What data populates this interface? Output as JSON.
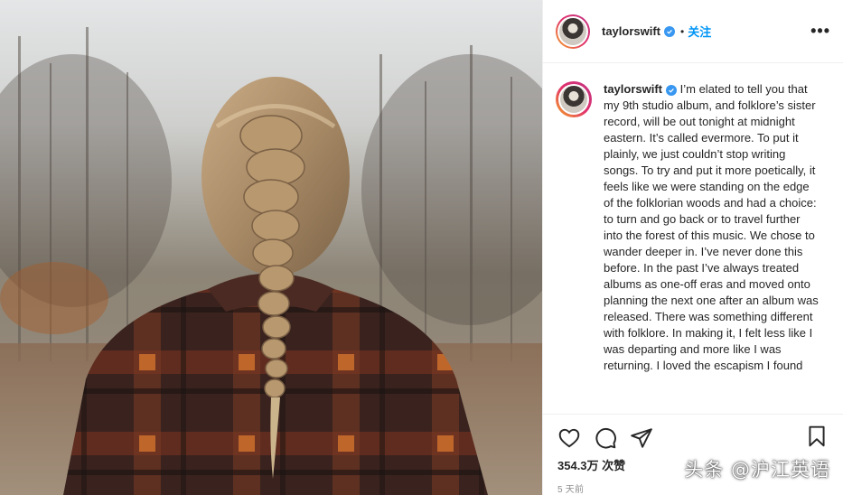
{
  "header": {
    "username": "taylorswift",
    "separator": "•",
    "follow_label": "关注",
    "more_icon": "more-horizontal-icon",
    "more_label": "•••"
  },
  "caption": {
    "username": "taylorswift",
    "text": "I’m elated to tell you that my 9th studio album, and folklore’s sister record, will be out tonight at midnight eastern. It’s called evermore. To put it plainly, we just couldn’t stop writing songs. To try and put it more poetically, it feels like we were standing on the edge of the folklorian woods and had a choice: to turn and go back or to travel further into the forest of this music. We chose to wander deeper in. I’ve never done this before. In the past I’ve always treated albums as one-off eras and moved onto planning the next one after an album was released. There was something different with folklore. In making it, I felt less like I was departing and more like I was returning. I loved the escapism I found"
  },
  "actions": {
    "icons": [
      "heart-icon",
      "comment-icon",
      "share-icon",
      "bookmark-icon"
    ],
    "likes": "354.3万 次赞",
    "time_ago": "5 天前"
  },
  "watermark": "头条 @沪江英语",
  "colors": {
    "follow": "#0095f6",
    "verified": "#3897f0",
    "text": "#262626",
    "muted": "#8e8e8e"
  }
}
